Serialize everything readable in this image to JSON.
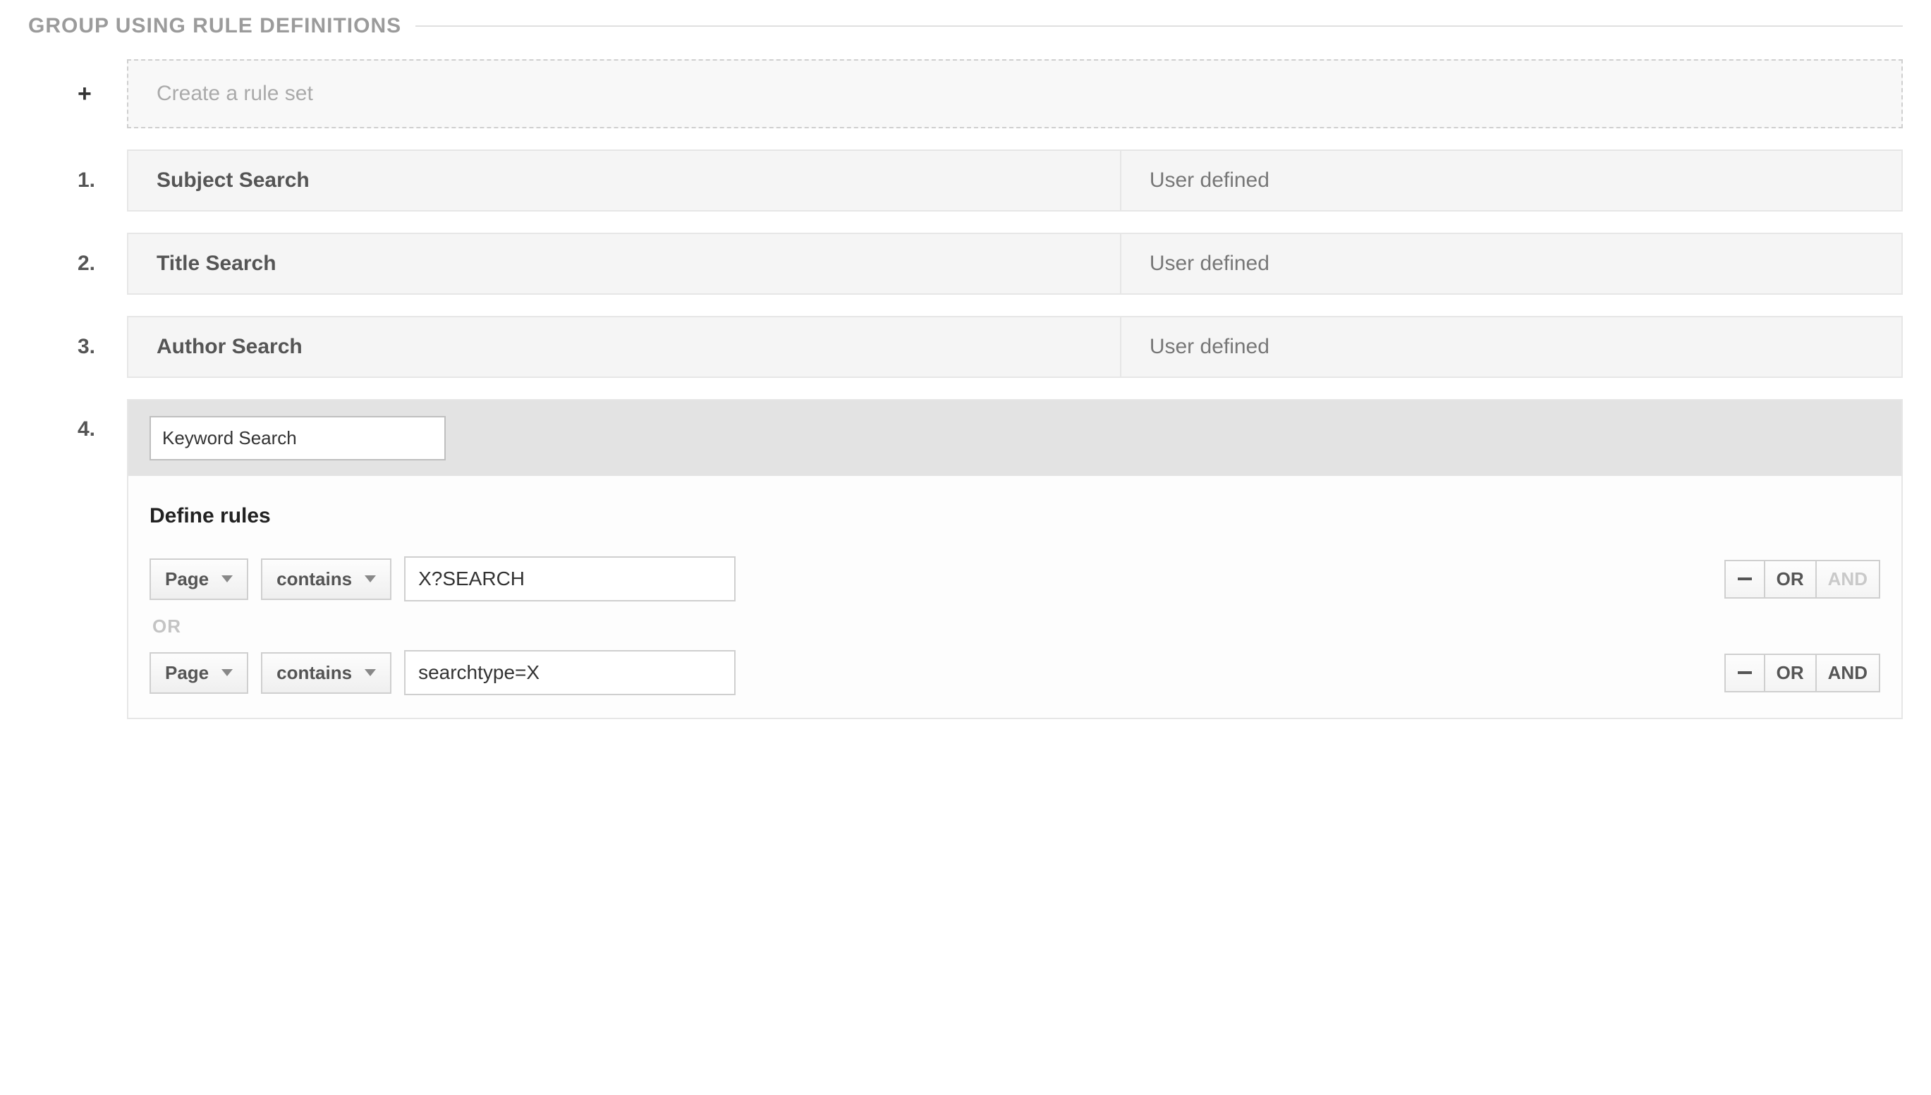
{
  "section": {
    "title": "GROUP USING RULE DEFINITIONS"
  },
  "create": {
    "plus": "+",
    "label": "Create a rule set"
  },
  "rules": {
    "0": {
      "number": "1.",
      "name": "Subject Search",
      "status": "User defined"
    },
    "1": {
      "number": "2.",
      "name": "Title Search",
      "status": "User defined"
    },
    "2": {
      "number": "3.",
      "name": "Author Search",
      "status": "User defined"
    }
  },
  "expanded": {
    "number": "4.",
    "name": "Keyword Search",
    "define_title": "Define rules",
    "or_label": "OR",
    "rows": {
      "0": {
        "dimension": "Page",
        "operator": "contains",
        "value": "X?SEARCH",
        "ops": {
          "minus": "−",
          "or": "OR",
          "and": "AND",
          "and_disabled": true
        }
      },
      "1": {
        "dimension": "Page",
        "operator": "contains",
        "value": "searchtype=X",
        "ops": {
          "minus": "−",
          "or": "OR",
          "and": "AND",
          "and_disabled": false
        }
      }
    }
  }
}
